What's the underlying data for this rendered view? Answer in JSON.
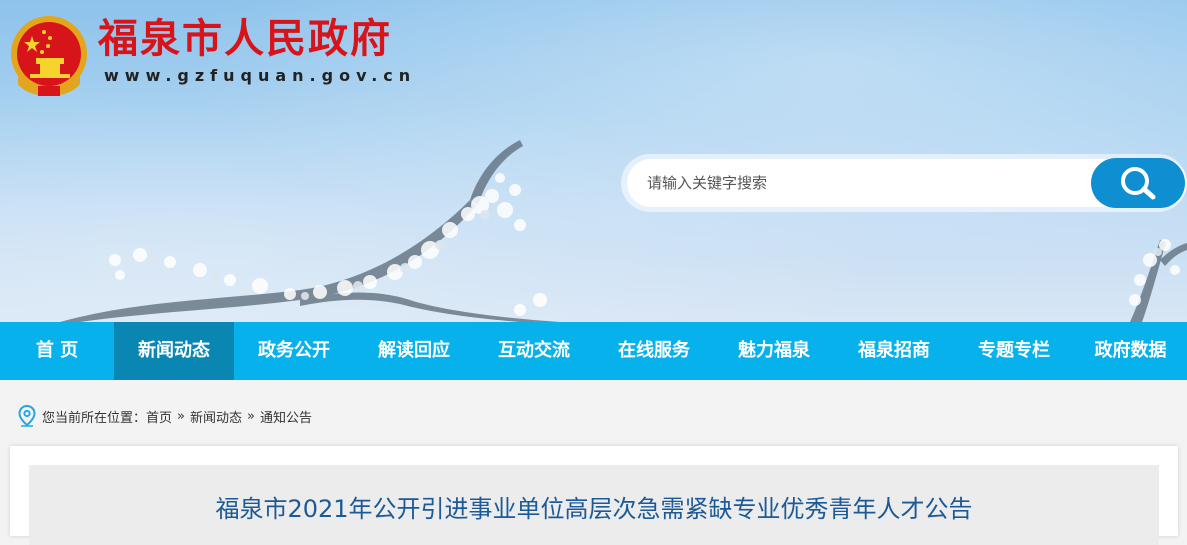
{
  "header": {
    "site_title": "福泉市人民政府",
    "site_url": "www.gzfuquan.gov.cn"
  },
  "search": {
    "placeholder": "请输入关键字搜索"
  },
  "nav": {
    "items": [
      {
        "label": "首 页"
      },
      {
        "label": "新闻动态",
        "active": true
      },
      {
        "label": "政务公开"
      },
      {
        "label": "解读回应"
      },
      {
        "label": "互动交流"
      },
      {
        "label": "在线服务"
      },
      {
        "label": "魅力福泉"
      },
      {
        "label": "福泉招商"
      },
      {
        "label": "专题专栏"
      },
      {
        "label": "政府数据"
      }
    ]
  },
  "breadcrumb": {
    "prefix": "您当前所在位置：",
    "items": [
      "首页",
      "新闻动态",
      "通知公告"
    ],
    "separator": "»"
  },
  "article": {
    "title": "福泉市2021年公开引进事业单位高层次急需紧缺专业优秀青年人才公告"
  },
  "colors": {
    "title_red": "#d8141b",
    "nav_bg": "#07b2ec",
    "nav_active": "#0a86b3",
    "search_button": "#0f8fd2",
    "article_title": "#1b5a96"
  }
}
